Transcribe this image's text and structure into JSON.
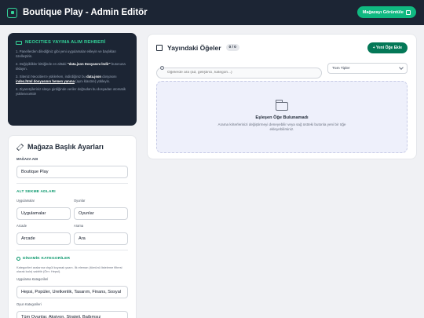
{
  "header": {
    "title": "Boutique Play - Admin Editör",
    "view_store_label": "Mağazayı Görüntüle"
  },
  "guide": {
    "title": "NEOCITIES YAYINA ALIM REHBERİ",
    "step1": "1. Panellerden dilediğiniz gibi yeni uygulamalar ekleyin ve başlıkları özelleştirin.",
    "step2_a": "2. Değişiklikler bittiğinde en alttaki ",
    "step2_b": "\"data.json Dosyasını İndir\"",
    "step2_c": " butonuna tıklayın.",
    "step3_a": "3. Sitenizi Neocities'e yüklerken, indirdiğiniz bu ",
    "step3_b": "data.json",
    "step3_c": " dosyasını ",
    "step3_d": "index.html dosyasının hemen yanına",
    "step3_e": " (aynı klasöre) yükleyin.",
    "step4": "4. Ziyaretçileriniz siteye girdiğinde veriler doğrudan bu dosyadan otomatik yüklenecektir!"
  },
  "settings": {
    "title": "Mağaza Başlık Ayarları",
    "store_name_label": "MAĞAZA ADI",
    "store_name_value": "Boutique Play",
    "tabs_section": "ALT SEKME ADLARI",
    "apps_label": "Uygulamalar",
    "apps_value": "Uygulamalar",
    "games_label": "Oyunlar",
    "games_value": "Oyunlar",
    "arcade_label": "Arcade",
    "arcade_value": "Arcade",
    "search_label": "Arama",
    "search_value": "Ara",
    "dynamic_section": "DİNAMİK KATEGORİLER",
    "dynamic_help": "Kategorileri aralarına virgül koyarak yazın. İlk eleman (tümünü listeleme filtresi olarak kalır) sabittir (Örn: Hepsi).",
    "app_cat_label": "Uygulama Kategorileri",
    "app_cat_value": "Hepsi, Popüler, Üretkenlik, Tasarım, Finans, Sosyal",
    "game_cat_label": "Oyun Kategorileri",
    "game_cat_value": "Tüm Oyunlar, Aksiyon, Strateji, Bağımsız"
  },
  "items": {
    "title": "Yayındaki Öğeler",
    "count": "0 / 0",
    "add_label": "+ Yeni Öğe Ekle",
    "search_placeholder": "Öğelerde ara (ad, geliştirici, kategori...)",
    "type_filter": "Tüm Tipler",
    "empty_title": "Eşleşen Öğe Bulunamadı",
    "empty_text": "Arama kriterlerinizi değiştirmeyi deneyebilir veya sağ üstteki butonla yeni bir öğe ekleyebilirsiniz."
  }
}
